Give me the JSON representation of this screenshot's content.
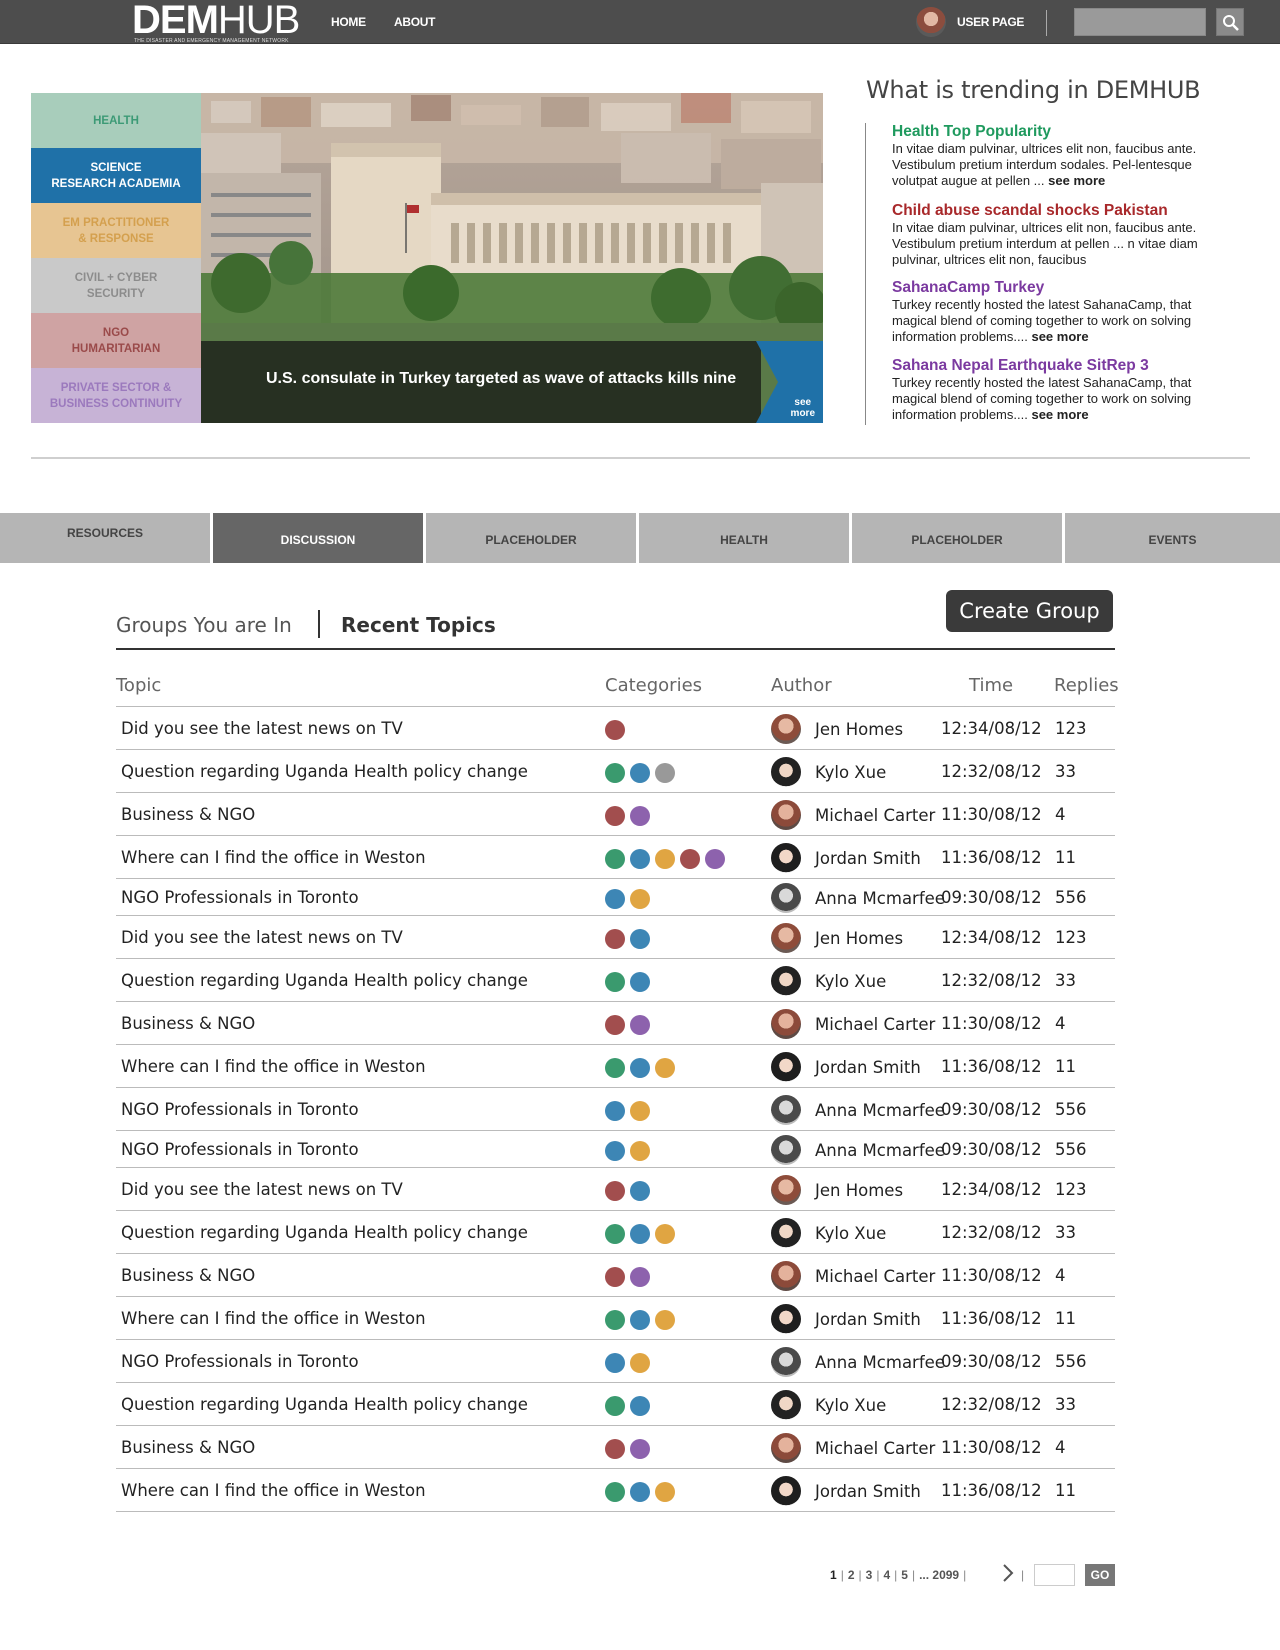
{
  "header": {
    "logo_main": "DEM",
    "logo_light": "HUB",
    "logo_tagline": "THE DISASTER AND EMERGENCY MANAGEMENT NETWORK",
    "nav": [
      {
        "label": "HOME"
      },
      {
        "label": "ABOUT"
      }
    ],
    "user_link": "USER PAGE",
    "search_icon": "search-icon"
  },
  "categories": [
    {
      "label": "HEALTH",
      "bg": "#a8cdbb",
      "fg": "#3c9a76"
    },
    {
      "label": "SCIENCE\nRESEARCH ACADEMIA",
      "bg": "#1f71a8",
      "fg": "#ffffff"
    },
    {
      "label": "EM PRACTITIONER\n& RESPONSE",
      "bg": "#e7c592",
      "fg": "#d4a04e"
    },
    {
      "label": "CIVIL + CYBER\nSECURITY",
      "bg": "#c9c9c9",
      "fg": "#8c8c8c"
    },
    {
      "label": "NGO\nHUMARITARIAN",
      "bg": "#cfa3a3",
      "fg": "#9a4a4a"
    },
    {
      "label": "PRIVATE SECTOR &\nBUSINESS CONTINUITY",
      "bg": "#c7b3d6",
      "fg": "#9b79bd"
    }
  ],
  "hero": {
    "caption": "U.S. consulate in Turkey targeted as wave of attacks kills nine",
    "more_label": "see\nmore"
  },
  "trending": {
    "title": "What is trending in DEMHUB",
    "items": [
      {
        "title": "Health Top Popularity",
        "color": "#1f9a5e",
        "body": "In vitae diam pulvinar, ultrices elit non, faucibus ante. Vestibulum pretium interdum sodales. Pel-lentesque volutpat augue at pellen ...",
        "more": "see more"
      },
      {
        "title": "Child abuse scandal shocks Pakistan",
        "color": "#a8282a",
        "body": "In vitae diam pulvinar, ultrices elit non, faucibus ante. Vestibulum pretium interdum at pellen ... n vitae diam pulvinar, ultrices elit non, faucibus",
        "more": ""
      },
      {
        "title": "SahanaCamp Turkey",
        "color": "#7b3aa0",
        "body": "Turkey recently hosted the latest SahanaCamp, that magical blend of coming together to work on solving information problems....",
        "more": "see more"
      },
      {
        "title": "Sahana Nepal Earthquake SitRep 3",
        "color": "#7b3aa0",
        "body": "Turkey recently hosted the latest SahanaCamp, that magical blend of coming together to work on solving information problems....",
        "more": "see more"
      }
    ]
  },
  "tabs": [
    {
      "label": "RESOURCES",
      "active": false
    },
    {
      "label": "DISCUSSION",
      "active": true
    },
    {
      "label": "PLACEHOLDER",
      "active": false
    },
    {
      "label": "HEALTH",
      "active": false
    },
    {
      "label": "PLACEHOLDER",
      "active": false
    },
    {
      "label": "EVENTS",
      "active": false
    }
  ],
  "discussion": {
    "groups_link": "Groups You are In",
    "recent_topics": "Recent Topics",
    "create_button": "Create Group",
    "columns": [
      "Topic",
      "Categories",
      "Author",
      "Time",
      "Replies"
    ],
    "category_colors": {
      "red": "#a24e4e",
      "green": "#3a9a6e",
      "blue": "#3d86b5",
      "gray": "#999999",
      "orange": "#e0a542",
      "purple": "#8d62ad"
    },
    "rows": [
      {
        "topic": "Did you see the latest news on TV",
        "cats": [
          "red"
        ],
        "author": "Jen Homes",
        "time": "12:34/08/12",
        "replies": "123"
      },
      {
        "topic": "Question regarding Uganda Health policy change",
        "cats": [
          "green",
          "blue",
          "gray"
        ],
        "author": "Kylo Xue",
        "time": "12:32/08/12",
        "replies": "33"
      },
      {
        "topic": "Business & NGO",
        "cats": [
          "red",
          "purple"
        ],
        "author": "Michael Carter",
        "time": "11:30/08/12",
        "replies": "4"
      },
      {
        "topic": "Where can I find the office in Weston",
        "cats": [
          "green",
          "blue",
          "orange",
          "red",
          "purple"
        ],
        "author": "Jordan Smith",
        "time": "11:36/08/12",
        "replies": "11"
      },
      {
        "topic": "NGO Professionals in Toronto",
        "cats": [
          "blue",
          "orange"
        ],
        "author": "Anna Mcmarfee",
        "time": "09:30/08/12",
        "replies": "556"
      },
      {
        "topic": "Did you see the latest news on TV",
        "cats": [
          "red",
          "blue"
        ],
        "author": "Jen Homes",
        "time": "12:34/08/12",
        "replies": "123"
      },
      {
        "topic": "Question regarding Uganda Health policy change",
        "cats": [
          "green",
          "blue"
        ],
        "author": "Kylo Xue",
        "time": "12:32/08/12",
        "replies": "33"
      },
      {
        "topic": "Business & NGO",
        "cats": [
          "red",
          "purple"
        ],
        "author": "Michael Carter",
        "time": "11:30/08/12",
        "replies": "4"
      },
      {
        "topic": "Where can I find the office in Weston",
        "cats": [
          "green",
          "blue",
          "orange"
        ],
        "author": "Jordan Smith",
        "time": "11:36/08/12",
        "replies": "11"
      },
      {
        "topic": "NGO Professionals in Toronto",
        "cats": [
          "blue",
          "orange"
        ],
        "author": "Anna Mcmarfee",
        "time": "09:30/08/12",
        "replies": "556"
      },
      {
        "topic": "NGO Professionals in Toronto",
        "cats": [
          "blue",
          "orange"
        ],
        "author": "Anna Mcmarfee",
        "time": "09:30/08/12",
        "replies": "556"
      },
      {
        "topic": "Did you see the latest news on TV",
        "cats": [
          "red",
          "blue"
        ],
        "author": "Jen Homes",
        "time": "12:34/08/12",
        "replies": "123"
      },
      {
        "topic": "Question regarding Uganda Health policy change",
        "cats": [
          "green",
          "blue",
          "orange"
        ],
        "author": "Kylo Xue",
        "time": "12:32/08/12",
        "replies": "33"
      },
      {
        "topic": "Business & NGO",
        "cats": [
          "red",
          "purple"
        ],
        "author": "Michael Carter",
        "time": "11:30/08/12",
        "replies": "4"
      },
      {
        "topic": "Where can I find the office in Weston",
        "cats": [
          "green",
          "blue",
          "orange"
        ],
        "author": "Jordan Smith",
        "time": "11:36/08/12",
        "replies": "11"
      },
      {
        "topic": "NGO Professionals in Toronto",
        "cats": [
          "blue",
          "orange"
        ],
        "author": "Anna Mcmarfee",
        "time": "09:30/08/12",
        "replies": "556"
      },
      {
        "topic": "Question regarding Uganda Health policy change",
        "cats": [
          "green",
          "blue"
        ],
        "author": "Kylo Xue",
        "time": "12:32/08/12",
        "replies": "33"
      },
      {
        "topic": "Business & NGO",
        "cats": [
          "red",
          "purple"
        ],
        "author": "Michael Carter",
        "time": "11:30/08/12",
        "replies": "4"
      },
      {
        "topic": "Where can I find the office in Weston",
        "cats": [
          "green",
          "blue",
          "orange"
        ],
        "author": "Jordan Smith",
        "time": "11:36/08/12",
        "replies": "11"
      }
    ]
  },
  "pagination": {
    "pages": [
      "1",
      "2",
      "3",
      "4",
      "5",
      "... 2099"
    ],
    "next_icon": "chevron-right-icon",
    "go_label": "GO"
  }
}
